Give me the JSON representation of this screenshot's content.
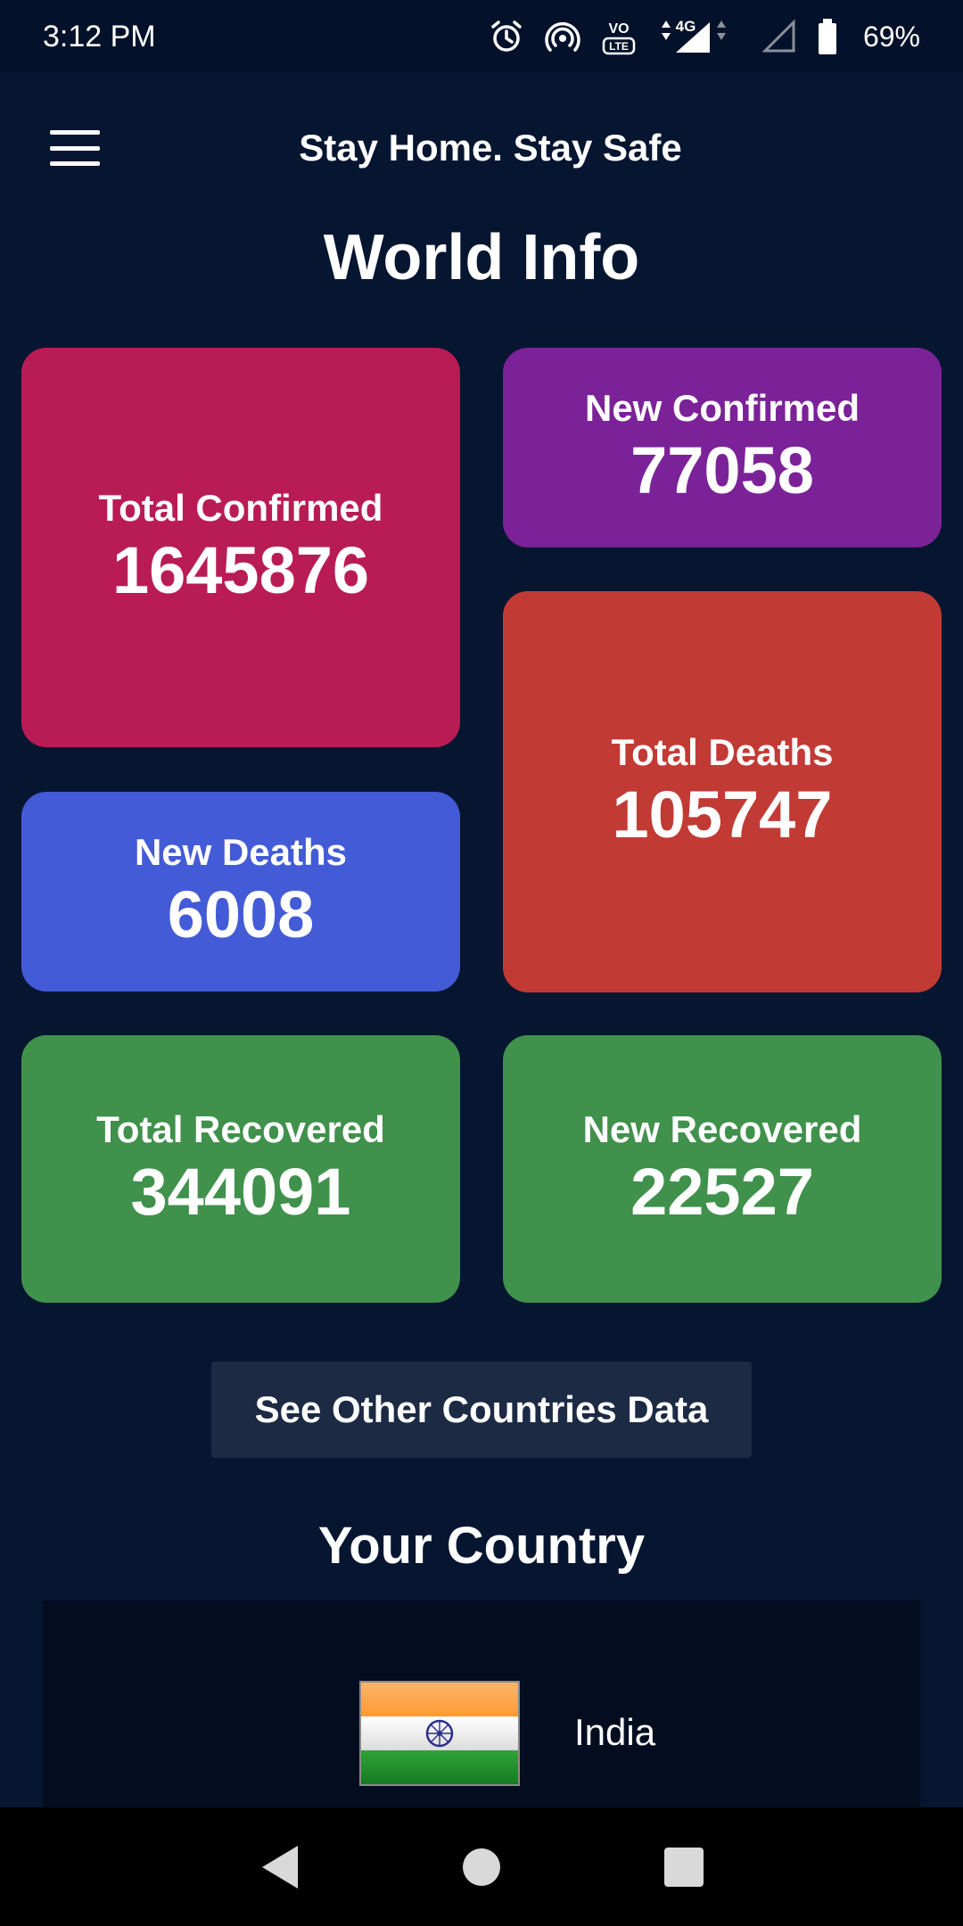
{
  "status_bar": {
    "time": "3:12 PM",
    "network": "4G",
    "volte": "VO LTE",
    "battery": "69%",
    "icons": [
      "alarm-icon",
      "hotspot-icon",
      "volte-icon",
      "signal-4g-icon",
      "signal-empty-icon",
      "battery-icon"
    ]
  },
  "app_bar": {
    "title": "Stay Home. Stay Safe",
    "menu_icon": "hamburger-menu-icon"
  },
  "world_info": {
    "title": "World Info",
    "cards": {
      "total_confirmed": {
        "label": "Total Confirmed",
        "value": "1645876",
        "color": "#b91c55"
      },
      "new_confirmed": {
        "label": "New Confirmed",
        "value": "77058",
        "color": "#7b2298"
      },
      "total_deaths": {
        "label": "Total Deaths",
        "value": "105747",
        "color": "#c23a34"
      },
      "new_deaths": {
        "label": "New Deaths",
        "value": "6008",
        "color": "#435bd6"
      },
      "total_recovered": {
        "label": "Total Recovered",
        "value": "344091",
        "color": "#3f914b"
      },
      "new_recovered": {
        "label": "New Recovered",
        "value": "22527",
        "color": "#3f914b"
      }
    }
  },
  "see_other_button": "See Other Countries Data",
  "your_country": {
    "title": "Your Country",
    "country_name": "India",
    "flag_icon": "india-flag-icon"
  },
  "nav_bar": {
    "icons": [
      "back-icon",
      "home-icon",
      "recents-icon"
    ]
  },
  "colors": {
    "background": "#061530",
    "status_bar": "#04112a",
    "button": "#1c2a44",
    "country_card": "#030d1f"
  }
}
